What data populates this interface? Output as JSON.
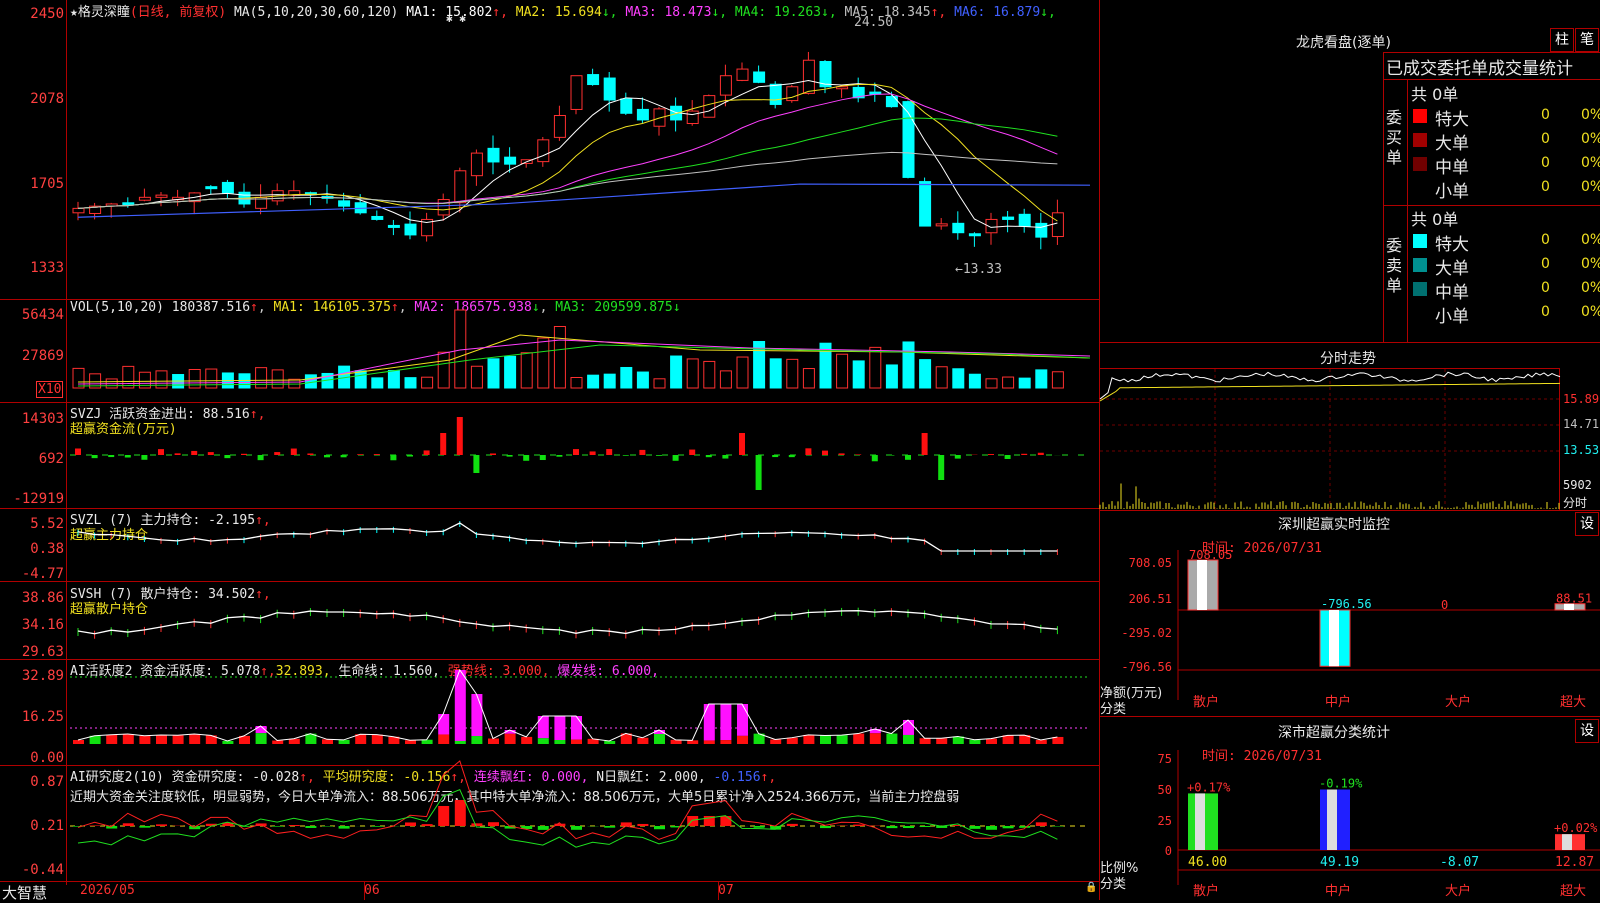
{
  "stock": {
    "name": "格灵深瞳",
    "mode": "(日线, 前复权)",
    "star": "★"
  },
  "main": {
    "yticks": [
      "2450",
      "2078",
      "1705",
      "1333"
    ],
    "ma_label": "MA(5,10,20,30,60,120)",
    "ma_values": [
      {
        "label": "MA1:",
        "value": "15.802",
        "arrow": "↑",
        "color": "#ffffff"
      },
      {
        "label": "MA2:",
        "value": "15.694",
        "arrow": "↓",
        "color": "#f0e020"
      },
      {
        "label": "MA3:",
        "value": "18.473",
        "arrow": "↓",
        "color": "#ff40ff"
      },
      {
        "label": "MA4:",
        "value": "19.263",
        "arrow": "↓",
        "color": "#20e020"
      },
      {
        "label": "MA5:",
        "value": "18.345",
        "arrow": "↑",
        "color": "#c0c0c0"
      },
      {
        "label": "MA6:",
        "value": "16.879",
        "arrow": "↓",
        "color": "#4060ff"
      }
    ],
    "high_marker": "24.50",
    "low_marker": "←13.33",
    "stars": "✱ ✱"
  },
  "vol": {
    "header": "VOL(5,10,20)",
    "value": "180387.516",
    "arrow": "↑",
    "ma1": "MA1: 146105.375",
    "ma2": "MA2: 186575.938",
    "ma3": "MA3: 209599.875",
    "yticks": [
      "56434",
      "27869"
    ],
    "unit": "X10"
  },
  "svzj": {
    "header": "SVZJ  活跃资金进出: 88.516",
    "arrow": "↑,",
    "sub": "超赢资金流(万元)",
    "yticks": [
      "14303",
      "692",
      "-12919"
    ]
  },
  "svzl": {
    "header": "SVZL (7) 主力持仓: -2.195",
    "arrow": "↑,",
    "sub": "超赢主力持仓",
    "yticks": [
      "5.52",
      "0.38",
      "-4.77"
    ]
  },
  "svsh": {
    "header": "SVSH (7) 散户持仓: 34.502",
    "arrow": "↑,",
    "sub": "超赢散户持仓",
    "yticks": [
      "38.86",
      "34.16",
      "29.63"
    ]
  },
  "ai1": {
    "header": "AI活跃度2 资金活跃度: 5.078",
    "a1": "↑,",
    "v2": "32.893,",
    "v3": " 生命线: 1.560,",
    "v4": " 强势线: 3.000,",
    "v5": " 爆发线: 6.000,",
    "yticks": [
      "32.89",
      "16.25",
      "0.00"
    ]
  },
  "ai2": {
    "header": "AI研究度2(10) 资金研究度: -0.028",
    "a1": "↑,",
    "v2": " 平均研究度: -0.156",
    "a2": "↑,",
    "v3": " 连续飘红: 0.000,",
    "v4": " N日飘红: 2.000,",
    "v5": " -0.156",
    "a5": "↑,",
    "summary": "近期大资金关注度较低，明显弱势，今日大单净流入：88.506万元，其中特大单净流入：88.506万元，大单5日累计净入2524.366万元，当前主力控盘弱",
    "yticks": [
      "0.87",
      "0.21",
      "-0.44"
    ]
  },
  "xaxis": {
    "brand": "大智慧",
    "labels": [
      "2026/05",
      "06",
      "07"
    ]
  },
  "right": {
    "lhb_title": "龙虎看盘(逐单)",
    "btn1": "柱",
    "btn2": "笔",
    "stats_title": "已成交委托单成交量统计",
    "buy_label": "委买单",
    "sell_label": "委卖单",
    "buy_total": "共 0单",
    "sell_total": "共 0单",
    "buy_rows": [
      {
        "name": "特大",
        "n": "0",
        "p": "0%",
        "color": "#ff0000"
      },
      {
        "name": "大单",
        "n": "0",
        "p": "0%",
        "color": "#a00000"
      },
      {
        "name": "中单",
        "n": "0",
        "p": "0%",
        "color": "#700000"
      },
      {
        "name": "小单",
        "n": "0",
        "p": "0%",
        "color": ""
      }
    ],
    "sell_rows": [
      {
        "name": "特大",
        "n": "0",
        "p": "0%",
        "color": "#00ffff"
      },
      {
        "name": "大单",
        "n": "0",
        "p": "0%",
        "color": "#009090"
      },
      {
        "name": "中单",
        "n": "0",
        "p": "0%",
        "color": "#007070"
      },
      {
        "name": "小单",
        "n": "0",
        "p": "0%",
        "color": ""
      }
    ],
    "intraday_title": "分时走势",
    "intraday_ticks": [
      "15.89",
      "14.71",
      "13.53",
      "5902",
      "分时"
    ],
    "sz_title": "深圳超赢实时监控",
    "sz_btn": "设",
    "sz_time": "时间: 2026/07/31",
    "sz_yticks": [
      "708.05",
      "206.51",
      "-295.02",
      "-796.56"
    ],
    "sz_bars": [
      {
        "name": "散户",
        "value": 708.05,
        "label": "708.05"
      },
      {
        "name": "中户",
        "value": -796.56,
        "label": "-796.56"
      },
      {
        "name": "大户",
        "value": 0,
        "label": "0"
      },
      {
        "name": "超大",
        "value": 88.51,
        "label": "88.51"
      }
    ],
    "sz_unit": "净额(万元)",
    "sz_cat": "分类",
    "cls_title": "深市超赢分类统计",
    "cls_btn": "设",
    "cls_time": "时间: 2026/07/31",
    "cls_yticks": [
      "75",
      "50",
      "25",
      "0"
    ],
    "cls_bars": [
      {
        "name": "散户",
        "value": 46.0,
        "label": "46.00",
        "pct": "+0.17%"
      },
      {
        "name": "中户",
        "value": 49.19,
        "label": "49.19",
        "pct": "-0.19%"
      },
      {
        "name": "大户",
        "value": -8.07,
        "label": "-8.07",
        "pct": ""
      },
      {
        "name": "超大",
        "value": 12.87,
        "label": "12.87",
        "pct": "+0.02%"
      }
    ],
    "cls_unit": "比例%",
    "cls_cat": "分类"
  }
}
